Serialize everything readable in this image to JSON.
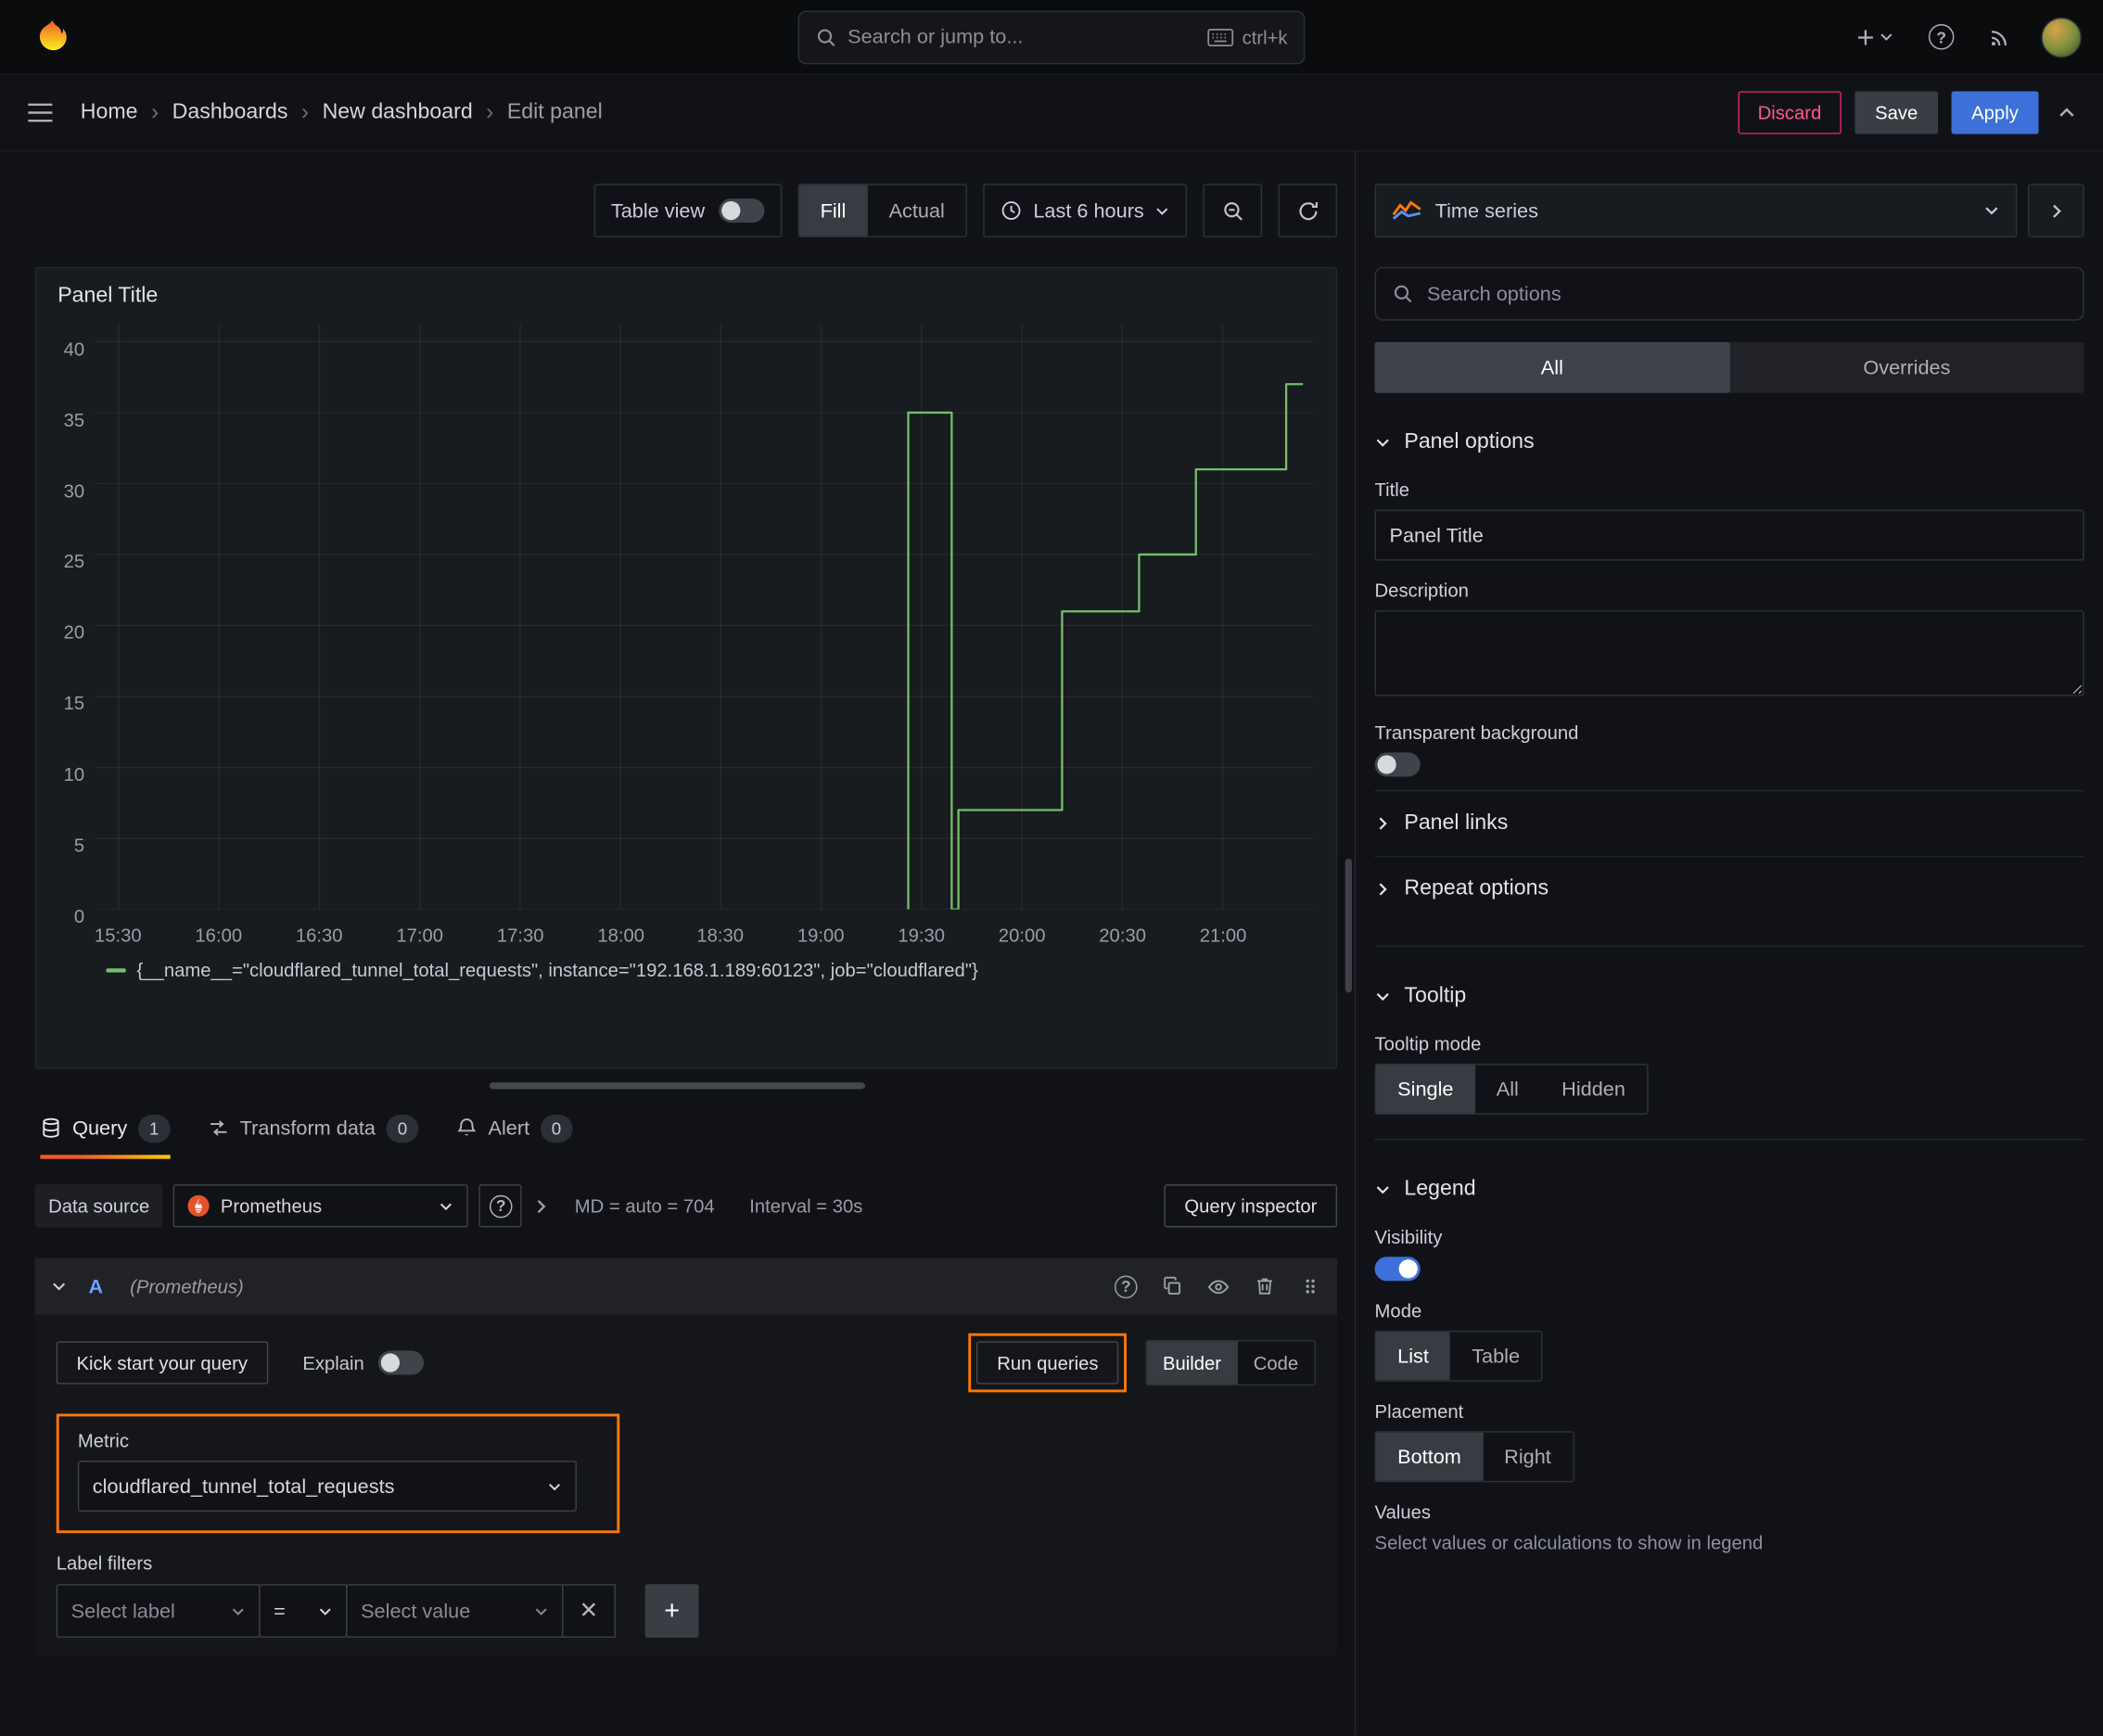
{
  "topnav": {
    "search": {
      "placeholder": "Search or jump to...",
      "shortcut": "ctrl+k"
    }
  },
  "breadcrumbs": {
    "items": [
      {
        "label": "Home"
      },
      {
        "label": "Dashboards"
      },
      {
        "label": "New dashboard"
      },
      {
        "label": "Edit panel"
      }
    ]
  },
  "header_actions": {
    "discard": "Discard",
    "save": "Save",
    "apply": "Apply"
  },
  "panel_toolbar": {
    "table_view": "Table view",
    "fill": "Fill",
    "actual": "Actual",
    "time_range": "Last 6 hours"
  },
  "panel": {
    "title": "Panel Title"
  },
  "chart_data": {
    "type": "line",
    "mode": "stepped",
    "title": "Panel Title",
    "series_color": "#73bf69",
    "grid": true,
    "legend_position": "bottom",
    "legend_label": "{__name__=\"cloudflared_tunnel_total_requests\", instance=\"192.168.1.189:60123\", job=\"cloudflared\"}",
    "x_ticks": [
      "15:30",
      "16:00",
      "16:30",
      "17:00",
      "17:30",
      "18:00",
      "18:30",
      "19:00",
      "19:30",
      "20:00",
      "20:30",
      "21:00"
    ],
    "x_tick_minutes": [
      930,
      960,
      990,
      1020,
      1050,
      1080,
      1110,
      1140,
      1170,
      1200,
      1230,
      1260
    ],
    "x_range_minutes": [
      923,
      1287
    ],
    "y_ticks": [
      0,
      5,
      10,
      15,
      20,
      25,
      30,
      35,
      40
    ],
    "y_range": [
      0,
      41.2
    ],
    "points_minutes_value": [
      [
        1166,
        0
      ],
      [
        1166,
        35
      ],
      [
        1179,
        35
      ],
      [
        1179,
        0
      ],
      [
        1181,
        0
      ],
      [
        1181,
        7
      ],
      [
        1212,
        7
      ],
      [
        1212,
        21
      ],
      [
        1235,
        21
      ],
      [
        1235,
        25
      ],
      [
        1252,
        25
      ],
      [
        1252,
        31
      ],
      [
        1279,
        31
      ],
      [
        1279,
        37
      ],
      [
        1284,
        37
      ]
    ]
  },
  "tabs": [
    {
      "label": "Query",
      "badge": "1"
    },
    {
      "label": "Transform data",
      "badge": "0"
    },
    {
      "label": "Alert",
      "badge": "0"
    }
  ],
  "query_editor": {
    "datasource_label": "Data source",
    "datasource_value": "Prometheus",
    "stats_md": "MD = auto = 704",
    "stats_interval": "Interval = 30s",
    "query_inspector": "Query inspector",
    "query_ref": "A",
    "query_ds": "(Prometheus)",
    "kickstart": "Kick start your query",
    "explain": "Explain",
    "run_queries": "Run queries",
    "builder": "Builder",
    "code": "Code",
    "metric_label": "Metric",
    "metric_value": "cloudflared_tunnel_total_requests",
    "label_filters_label": "Label filters",
    "select_label_placeholder": "Select label",
    "operator": "=",
    "select_value_placeholder": "Select value"
  },
  "viz_picker": {
    "name": "Time series"
  },
  "options_pane": {
    "search_placeholder": "Search options",
    "tabs": {
      "all": "All",
      "overrides": "Overrides"
    },
    "panel_options": {
      "title": "Panel options",
      "title_label": "Title",
      "title_value": "Panel Title",
      "description_label": "Description",
      "transparent_label": "Transparent background",
      "panel_links": "Panel links",
      "repeat_options": "Repeat options"
    },
    "tooltip": {
      "title": "Tooltip",
      "mode_label": "Tooltip mode",
      "modes": [
        "Single",
        "All",
        "Hidden"
      ],
      "active_mode": "Single"
    },
    "legend": {
      "title": "Legend",
      "visibility_label": "Visibility",
      "mode_label": "Mode",
      "modes": [
        "List",
        "Table"
      ],
      "active_mode": "List",
      "placement_label": "Placement",
      "placements": [
        "Bottom",
        "Right"
      ],
      "active_placement": "Bottom",
      "values_label": "Values",
      "values_hint": "Select values or calculations to show in legend"
    }
  },
  "colors": {
    "accent_orange": "#ff780a",
    "primary_blue": "#3d71d9",
    "series_green": "#73bf69",
    "danger_pink": "#ff5c8a"
  }
}
